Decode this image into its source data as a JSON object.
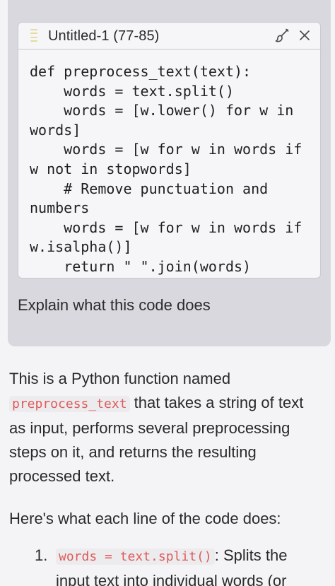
{
  "prompt": {
    "code_card": {
      "title": "Untitled-1 (77-85)",
      "brush_icon": "paintbrush-icon",
      "close_icon": "close-icon",
      "code": "def preprocess_text(text):\n    words = text.split()\n    words = [w.lower() for w in\nwords]\n    words = [w for w in words if\nw not in stopwords]\n    # Remove punctuation and\nnumbers\n    words = [w for w in words if\nw.isalpha()]\n    return \" \".join(words)"
    },
    "text": "Explain what this code does"
  },
  "answer": {
    "p1_before": "This is a Python function named ",
    "p1_code": "preprocess_text",
    "p1_after": " that takes a string of text as input, performs several preprocessing steps on it, and returns the resulting processed text.",
    "p2": "Here's what each line of the code does:",
    "steps": [
      {
        "number": "1.",
        "code": "words = text.split()",
        "text": ": Splits the input text into individual words (or"
      }
    ]
  },
  "colors": {
    "bubble": "#d8d8de",
    "card": "#f6f6f8",
    "inline_code_text": "#e05a5a",
    "page": "#f4f4f6"
  }
}
